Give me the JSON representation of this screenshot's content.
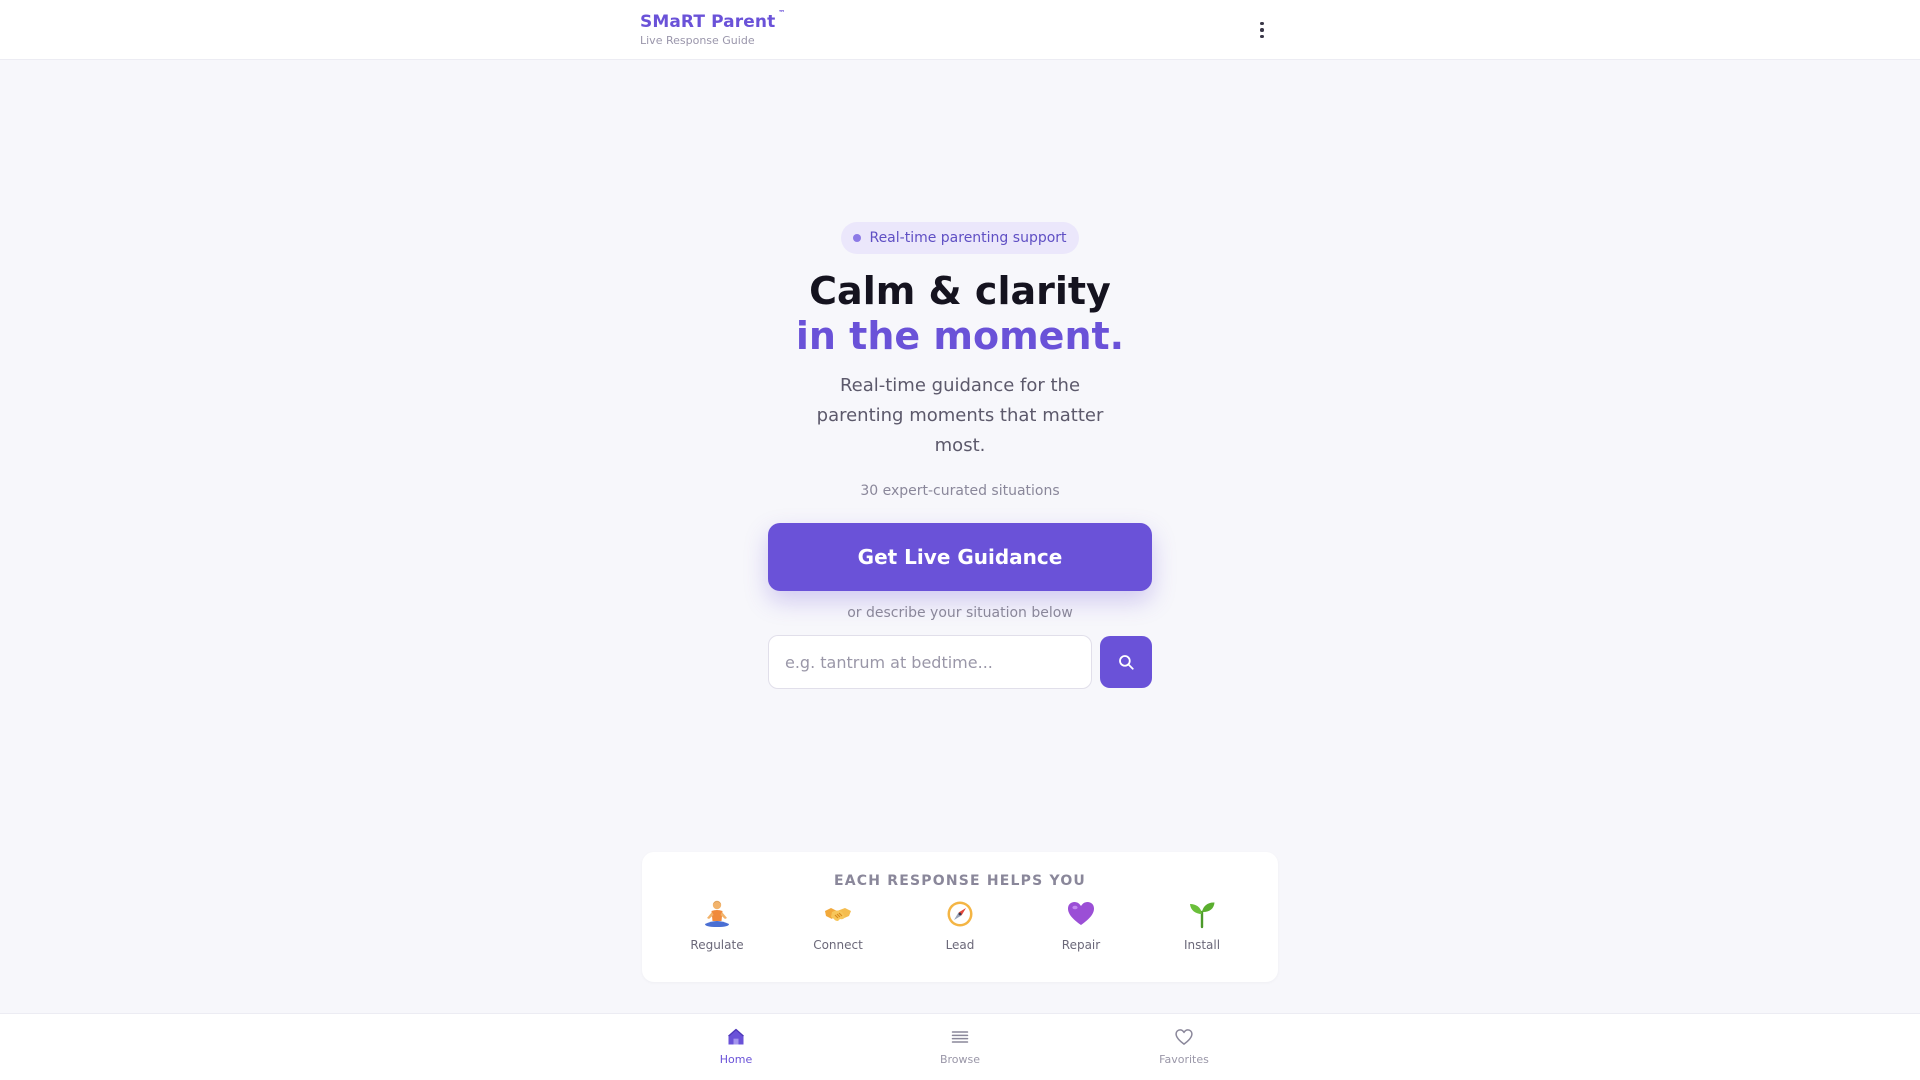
{
  "header": {
    "brand": "SMaRT Parent",
    "trademark": "™",
    "subtitle": "Live Response Guide",
    "menu_icon": "more-vertical-icon"
  },
  "hero": {
    "badge": "Real-time parenting support",
    "title_line1": "Calm & clarity",
    "title_line2": "in the moment.",
    "description": "Real-time guidance for the parenting moments that matter most.",
    "situations_count": "30 expert-curated situations",
    "cta_label": "Get Live Guidance",
    "alt_prompt": "or describe your situation below",
    "search_placeholder": "e.g. tantrum at bedtime...",
    "search_value": "",
    "search_icon": "search-icon"
  },
  "helps": {
    "title": "EACH RESPONSE HELPS YOU",
    "items": [
      {
        "label": "Regulate",
        "icon": "meditating-person-icon"
      },
      {
        "label": "Connect",
        "icon": "handshake-icon"
      },
      {
        "label": "Lead",
        "icon": "compass-icon"
      },
      {
        "label": "Repair",
        "icon": "purple-heart-icon"
      },
      {
        "label": "Install",
        "icon": "seedling-icon"
      }
    ]
  },
  "nav": {
    "items": [
      {
        "label": "Home",
        "icon": "home-icon",
        "active": true
      },
      {
        "label": "Browse",
        "icon": "list-icon",
        "active": false
      },
      {
        "label": "Favorites",
        "icon": "heart-outline-icon",
        "active": false
      }
    ]
  },
  "colors": {
    "accent": "#6a52d8",
    "accent_light": "#ebe7fb",
    "background": "#f7f7fb",
    "heading": "#15131f",
    "muted": "#8a879a"
  }
}
